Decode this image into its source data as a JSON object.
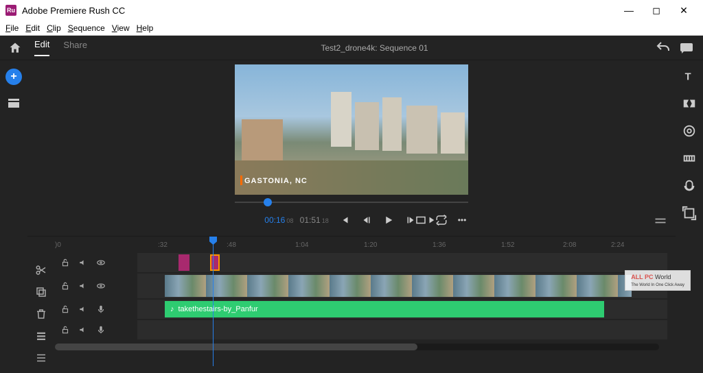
{
  "titlebar": {
    "app_name": "Adobe Premiere Rush CC",
    "logo_text": "Ru"
  },
  "menubar": {
    "items": [
      "File",
      "Edit",
      "Clip",
      "Sequence",
      "View",
      "Help"
    ]
  },
  "topbar": {
    "tabs": {
      "edit": "Edit",
      "share": "Share"
    },
    "project_title": "Test2_drone4k: Sequence 01"
  },
  "preview": {
    "location_overlay": "GASTONIA, NC"
  },
  "playback": {
    "current_time": "00:16",
    "current_frames": "08",
    "duration": "01:51",
    "duration_frames": "18"
  },
  "timeline": {
    "ruler_marks": [
      {
        "pos": 160,
        "label": ")0"
      },
      {
        "pos": 310,
        "label": ":32"
      },
      {
        "pos": 410,
        "label": ":48"
      },
      {
        "pos": 510,
        "label": "1:04"
      },
      {
        "pos": 610,
        "label": "1:20"
      },
      {
        "pos": 710,
        "label": "1:36"
      },
      {
        "pos": 810,
        "label": "1:52"
      },
      {
        "pos": 900,
        "label": "2:08"
      },
      {
        "pos": 970,
        "label": "2:24"
      }
    ],
    "audio_clip_label": "takethestairs-by_Panfur"
  },
  "watermark": {
    "brand": "ALL PC",
    "suffix": "World",
    "tagline": "The World In One Click Away"
  }
}
